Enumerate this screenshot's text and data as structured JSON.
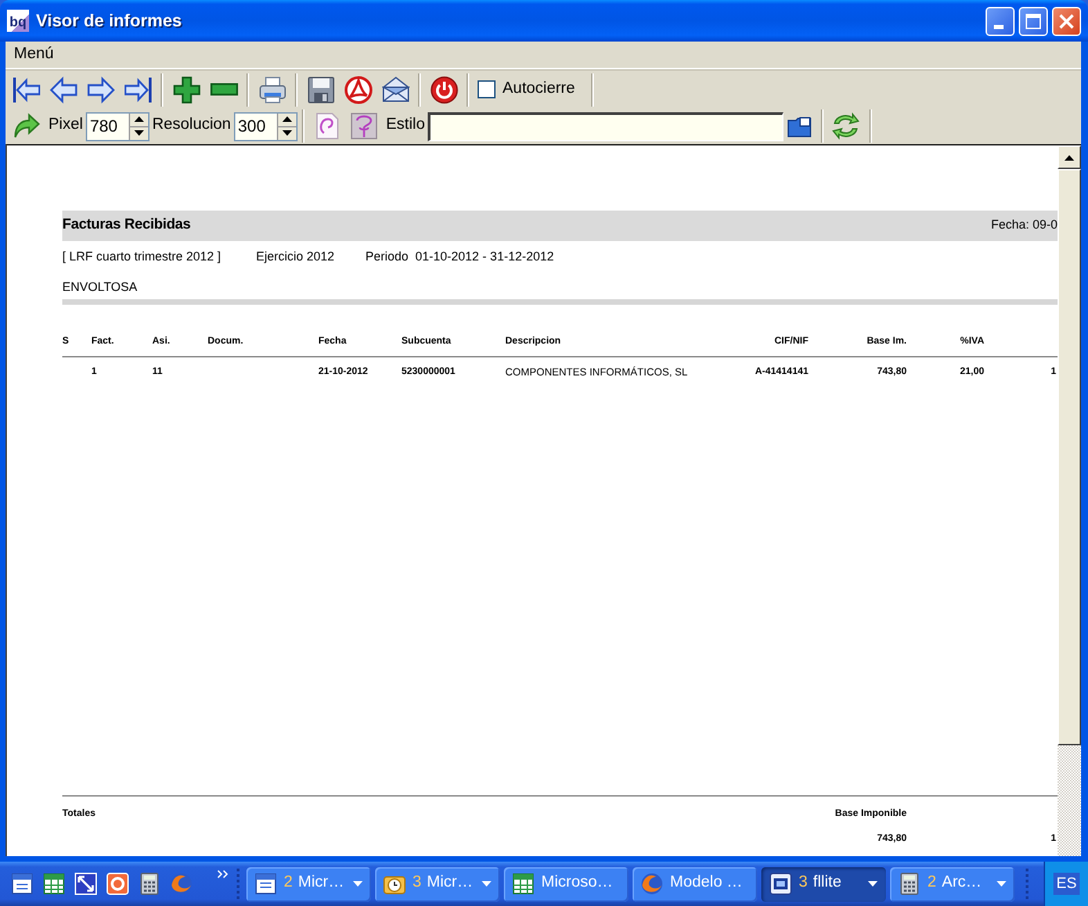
{
  "window": {
    "logo": "bq",
    "title": "Visor de informes"
  },
  "menu": [
    {
      "label": "Menú"
    }
  ],
  "toolbar": {
    "autoclose": {
      "label": "Autocierre",
      "checked": false
    }
  },
  "toolbar_2": {
    "pixel": {
      "label": "Pixel",
      "value": "780"
    },
    "resolucion": {
      "label": "Resolucion",
      "value": "300"
    },
    "estilo": {
      "label": "Estilo"
    }
  },
  "report": {
    "title": "Facturas Recibidas",
    "date": "Fecha: 09-0",
    "info": [
      "[ LRF cuarto trimestre 2012 ]",
      "Ejercicio 2012",
      "Periodo  01-10-2012 - 31-12-2012"
    ],
    "company": "ENVOLTOSA",
    "table": {
      "columns": [
        "S",
        "Fact.",
        "Asi.",
        "Docum.",
        "Fecha",
        "Subcuenta",
        "Descripcion",
        "CIF/NIF",
        "Base Im.",
        "%IVA"
      ],
      "rows": [
        [
          null,
          "1",
          "11",
          null,
          "21-10-2012",
          "5230000001",
          "COMPONENTES INFORMÁTICOS, SL",
          "A-41414141",
          "743,80",
          "21,00",
          "1"
        ]
      ]
    },
    "totals": {
      "label": "Totales",
      "heading": "Base Imponible",
      "value": "743,80",
      "column_11": "1"
    }
  },
  "taskbar": {
    "tasks": [
      {
        "count": "2",
        "label": "Micr…",
        "selected": false
      },
      {
        "count": "3",
        "label": "Micr…",
        "selected": false
      },
      {
        "label": "Microso…",
        "selected": false
      },
      {
        "label": "Modelo …",
        "selected": false
      },
      {
        "count": "3",
        "label": "fllite",
        "selected": true
      },
      {
        "count": "2",
        "label": "Arc…",
        "selected": false
      }
    ],
    "language": "ES"
  }
}
